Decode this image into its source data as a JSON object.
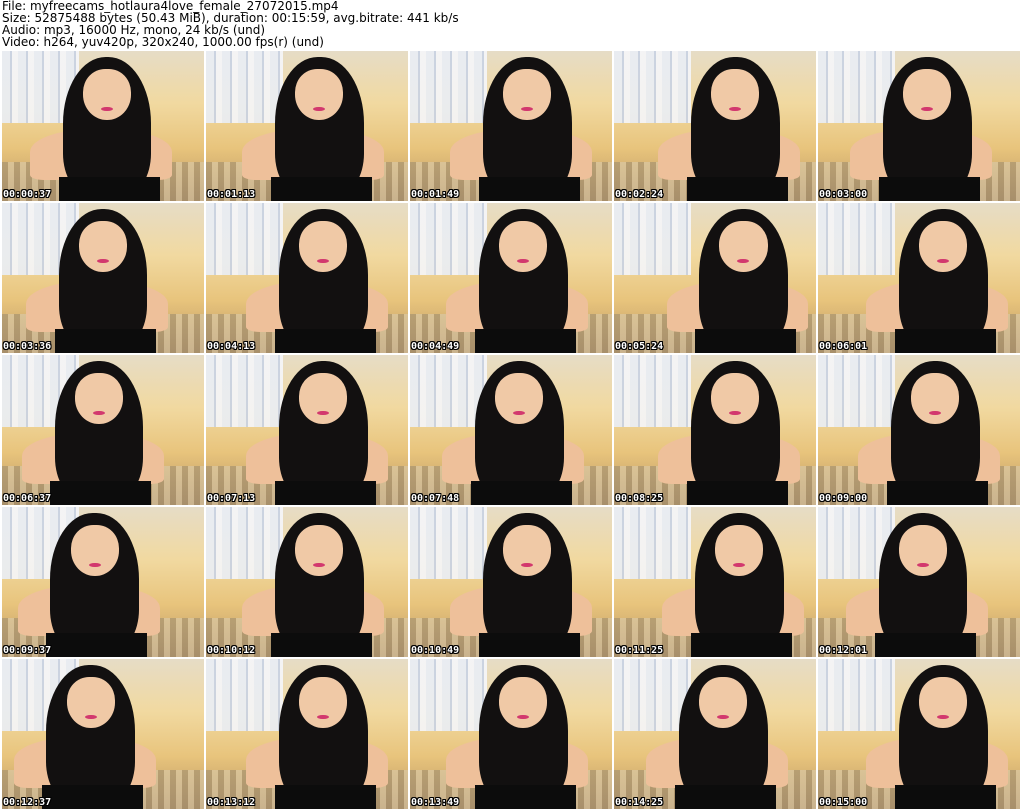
{
  "header": {
    "file": "File: myfreecams_hotlaura4love_female_27072015.mp4",
    "size": "Size: 52875488 bytes (50.43 MiB), duration: 00:15:59, avg.bitrate: 441 kb/s",
    "audio": "Audio: mp3, 16000 Hz, mono, 24 kb/s (und)",
    "video": "Video: h264, yuv420p, 320x240, 1000.00 fps(r) (und)"
  },
  "thumbnails": [
    {
      "time": "00:00:37"
    },
    {
      "time": "00:01:13"
    },
    {
      "time": "00:01:49"
    },
    {
      "time": "00:02:24"
    },
    {
      "time": "00:03:00"
    },
    {
      "time": "00:03:36"
    },
    {
      "time": "00:04:13"
    },
    {
      "time": "00:04:49"
    },
    {
      "time": "00:05:24"
    },
    {
      "time": "00:06:01"
    },
    {
      "time": "00:06:37"
    },
    {
      "time": "00:07:13"
    },
    {
      "time": "00:07:48"
    },
    {
      "time": "00:08:25"
    },
    {
      "time": "00:09:00"
    },
    {
      "time": "00:09:37"
    },
    {
      "time": "00:10:12"
    },
    {
      "time": "00:10:49"
    },
    {
      "time": "00:11:25"
    },
    {
      "time": "00:12:01"
    },
    {
      "time": "00:12:37"
    },
    {
      "time": "00:13:12"
    },
    {
      "time": "00:13:49"
    },
    {
      "time": "00:14:25"
    },
    {
      "time": "00:15:00"
    }
  ]
}
